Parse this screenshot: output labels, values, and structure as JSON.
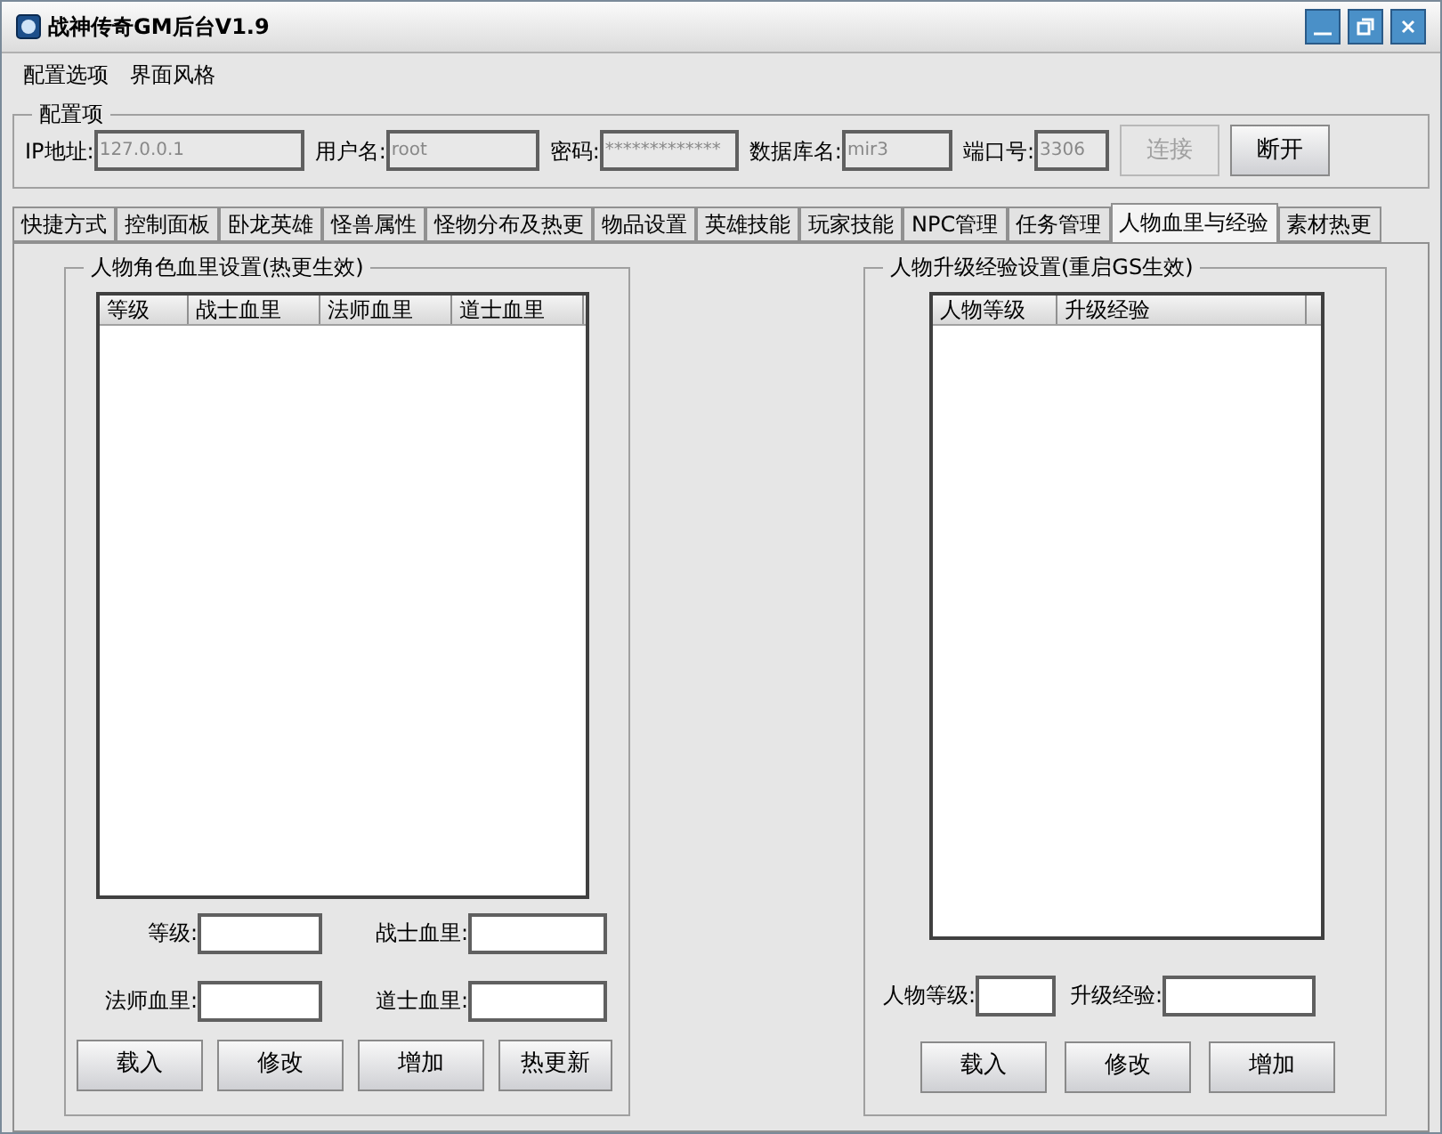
{
  "window": {
    "title": "战神传奇GM后台V1.9"
  },
  "menu": [
    "配置选项",
    "界面风格"
  ],
  "config": {
    "title": "配置项",
    "fields": [
      {
        "label": "IP地址:",
        "value": "127.0.0.1"
      },
      {
        "label": "用户名:",
        "value": "root"
      },
      {
        "label": "密码:",
        "value": "*************"
      },
      {
        "label": "数据库名:",
        "value": "mir3"
      },
      {
        "label": "端口号:",
        "value": "3306"
      }
    ],
    "buttons": [
      {
        "label": "连接",
        "disabled": true
      },
      {
        "label": "断开",
        "disabled": false
      }
    ]
  },
  "tabs": [
    {
      "label": "快捷方式",
      "selected": false
    },
    {
      "label": "控制面板",
      "selected": false
    },
    {
      "label": "卧龙英雄",
      "selected": false
    },
    {
      "label": "怪兽属性",
      "selected": false
    },
    {
      "label": "怪物分布及热更",
      "selected": false
    },
    {
      "label": "物品设置",
      "selected": false
    },
    {
      "label": "英雄技能",
      "selected": false
    },
    {
      "label": "玩家技能",
      "selected": false
    },
    {
      "label": "NPC管理",
      "selected": false
    },
    {
      "label": "任务管理",
      "selected": false
    },
    {
      "label": "人物血里与经验",
      "selected": true
    },
    {
      "label": "素材热更",
      "selected": false
    }
  ],
  "hp_panel": {
    "title": "人物角色血里设置(热更生效)",
    "columns": [
      "等级",
      "战士血里",
      "法师血里",
      "道士血里"
    ],
    "fields": [
      {
        "label": "等级:"
      },
      {
        "label": "战士血里:"
      },
      {
        "label": "法师血里:"
      },
      {
        "label": "道士血里:"
      }
    ],
    "buttons": [
      "载入",
      "修改",
      "增加",
      "热更新"
    ]
  },
  "exp_panel": {
    "title": "人物升级经验设置(重启GS生效)",
    "columns": [
      "人物等级",
      "升级经验"
    ],
    "fields": [
      {
        "label": "人物等级:"
      },
      {
        "label": "升级经验:"
      }
    ],
    "buttons": [
      "载入",
      "修改",
      "增加"
    ]
  }
}
